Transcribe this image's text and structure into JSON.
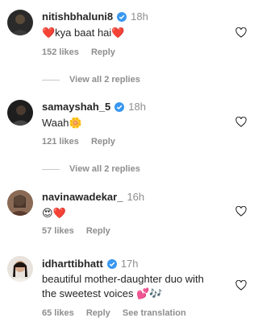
{
  "comments": [
    {
      "username": "nitishbhaluni8",
      "time": "18h",
      "text": "❤️kya baat hai❤️",
      "likes": "152 likes",
      "reply_label": "Reply",
      "view_replies": "View all 2 replies",
      "avatar_icon": "user-avatar-icon"
    },
    {
      "username": "samayshah_5",
      "time": "18h",
      "text": "Waah🌼",
      "likes": "121 likes",
      "reply_label": "Reply",
      "view_replies": "View all 2 replies",
      "avatar_icon": "user-avatar-icon"
    },
    {
      "username": "navinawadekar_",
      "time": "16h",
      "text": "😍❤️",
      "likes": "57 likes",
      "reply_label": "Reply",
      "avatar_icon": "user-avatar-icon"
    },
    {
      "username": "idharttibhatt",
      "time": "17h",
      "text_line1": "beautiful mother-daughter duo with",
      "text_line2": "the sweetest voices 💕🎶",
      "likes": "65 likes",
      "reply_label": "Reply",
      "translate_label": "See translation",
      "avatar_icon": "user-avatar-icon"
    }
  ],
  "colors": {
    "primary_text": "#262626",
    "secondary_text": "#8e8e8e",
    "verified_blue": "#3897f0",
    "heart_like": "#ed4956"
  }
}
